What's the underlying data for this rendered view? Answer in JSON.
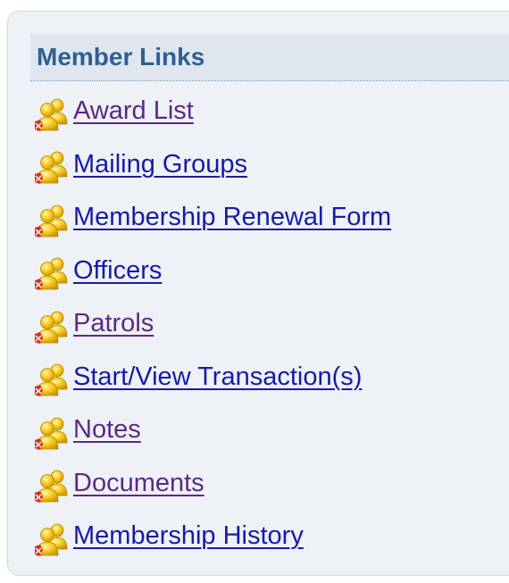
{
  "panel": {
    "title": "Member Links"
  },
  "links": [
    {
      "label": "Award List",
      "icon": "members-icon",
      "state": "visited"
    },
    {
      "label": "Mailing Groups",
      "icon": "members-icon",
      "state": "unvisited"
    },
    {
      "label": "Membership Renewal Form",
      "icon": "members-icon",
      "state": "unvisited"
    },
    {
      "label": "Officers",
      "icon": "members-icon",
      "state": "unvisited"
    },
    {
      "label": "Patrols",
      "icon": "members-icon",
      "state": "visited"
    },
    {
      "label": "Start/View Transaction(s)",
      "icon": "members-icon",
      "state": "unvisited"
    },
    {
      "label": "Notes",
      "icon": "members-icon",
      "state": "visited"
    },
    {
      "label": "Documents",
      "icon": "members-icon",
      "state": "visited"
    },
    {
      "label": "Membership History",
      "icon": "members-icon",
      "state": "unvisited"
    }
  ],
  "colors": {
    "header_text": "#2f5f8f",
    "link": "#1a1aa6",
    "visited_link": "#5b2a86",
    "panel_bg": "#eef1f6",
    "header_bg": "#dfe6ef"
  }
}
